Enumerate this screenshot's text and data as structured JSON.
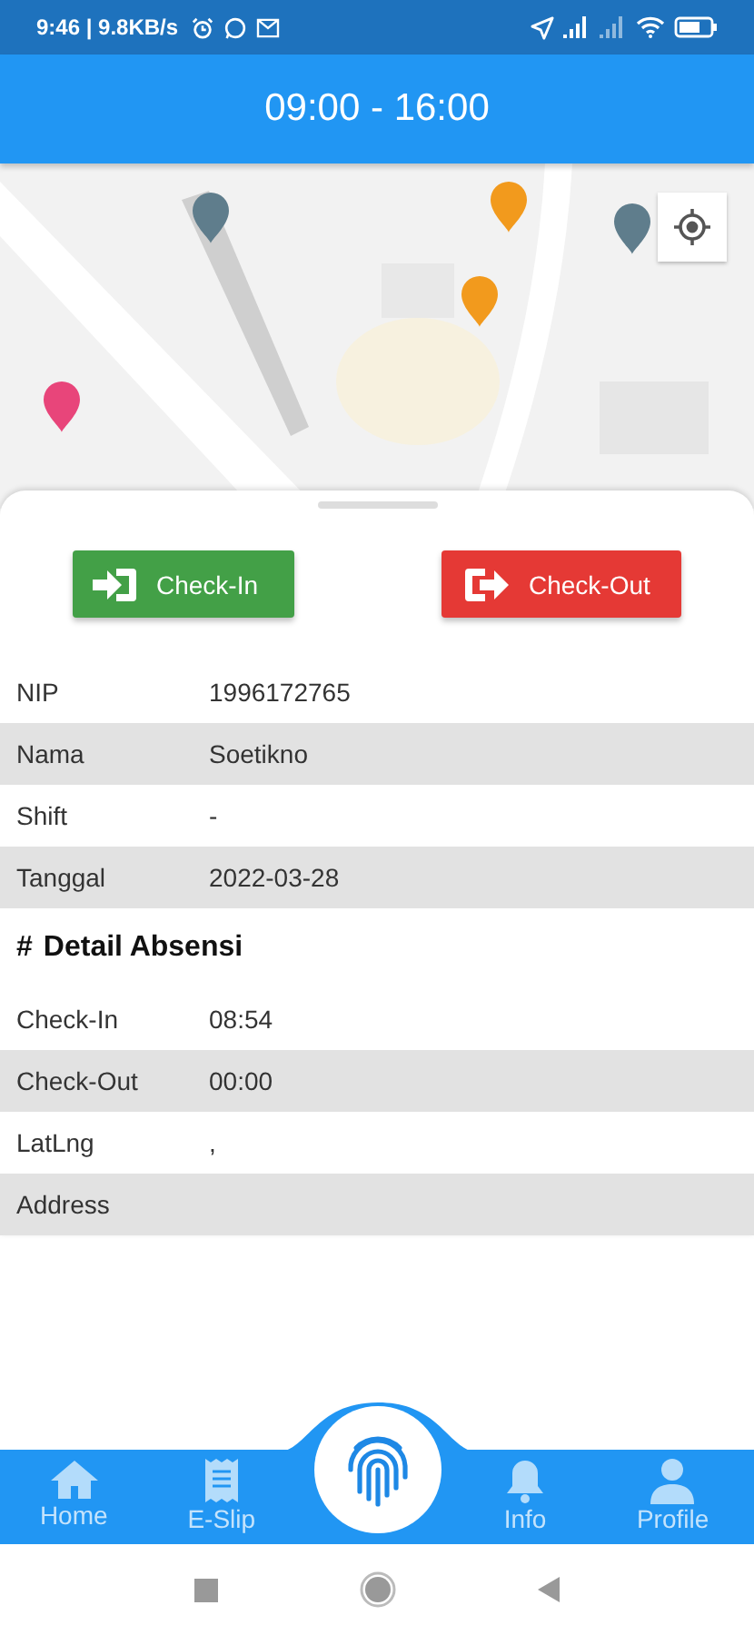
{
  "status_bar": {
    "time_speed": "9:46 | 9.8KB/s"
  },
  "header": {
    "title": "09:00 - 16:00"
  },
  "actions": [
    {
      "label": "Check-In",
      "kind": "in"
    },
    {
      "label": "Check-Out",
      "kind": "out"
    }
  ],
  "info_rows": [
    {
      "label": "NIP",
      "value": "1996172765"
    },
    {
      "label": "Nama",
      "value": "Soetikno"
    },
    {
      "label": "Shift",
      "value": "-"
    },
    {
      "label": "Tanggal",
      "value": "2022-03-28"
    }
  ],
  "detail": {
    "hash": "#",
    "title": "Detail Absensi"
  },
  "detail_rows": [
    {
      "label": "Check-In",
      "value": "08:54"
    },
    {
      "label": "Check-Out",
      "value": "00:00"
    },
    {
      "label": "LatLng",
      "value": ","
    },
    {
      "label": "Address"
    }
  ],
  "nav": {
    "left": [
      {
        "label": "Home"
      },
      {
        "label": "E-Slip"
      }
    ],
    "right": [
      {
        "label": "Info"
      },
      {
        "label": "Profile"
      }
    ]
  }
}
